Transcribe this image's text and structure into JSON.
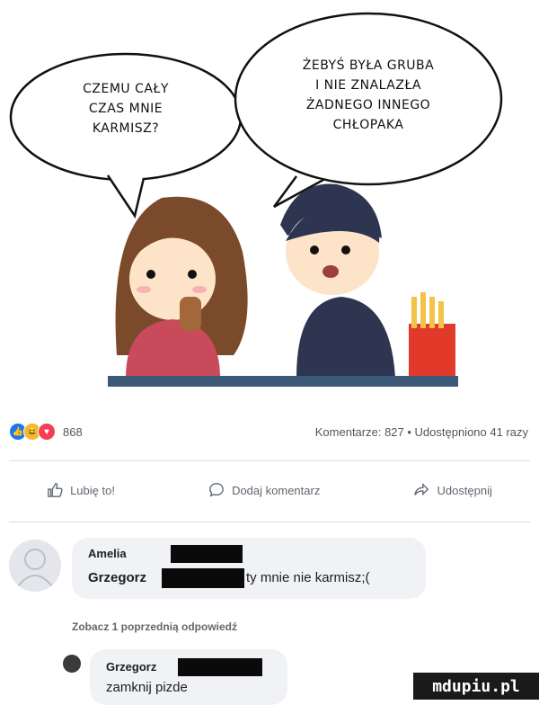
{
  "comic": {
    "girl_bubble": [
      "CZEMU CAŁY",
      "CZAS MNIE",
      "KARMISZ?"
    ],
    "boy_bubble": [
      "ŻEBYŚ BYŁA GRUBA",
      "I NIE ZNALAZŁA",
      "ŻADNEGO INNEGO",
      "CHŁOPAKA"
    ]
  },
  "post_stats": {
    "reaction_count": "868",
    "comments_shares": "Komentarze: 827 • Udostępniono 41 razy"
  },
  "actions": {
    "like": "Lubię to!",
    "comment": "Dodaj komentarz",
    "share": "Udostępnij"
  },
  "comment1": {
    "name_line1": "Amelia",
    "name_line2": "Grzegorz",
    "text": "ty mnie nie karmisz;("
  },
  "previous_replies": "Zobacz 1 poprzednią odpowiedź",
  "comment2": {
    "name": "Grzegorz",
    "text": "zamknij pizde"
  },
  "watermark": "mdupiu.pl",
  "colors": {
    "like": "#1877f2",
    "haha": "#f7b928",
    "love": "#f33e58",
    "bubble_bg": "#f0f2f5"
  }
}
